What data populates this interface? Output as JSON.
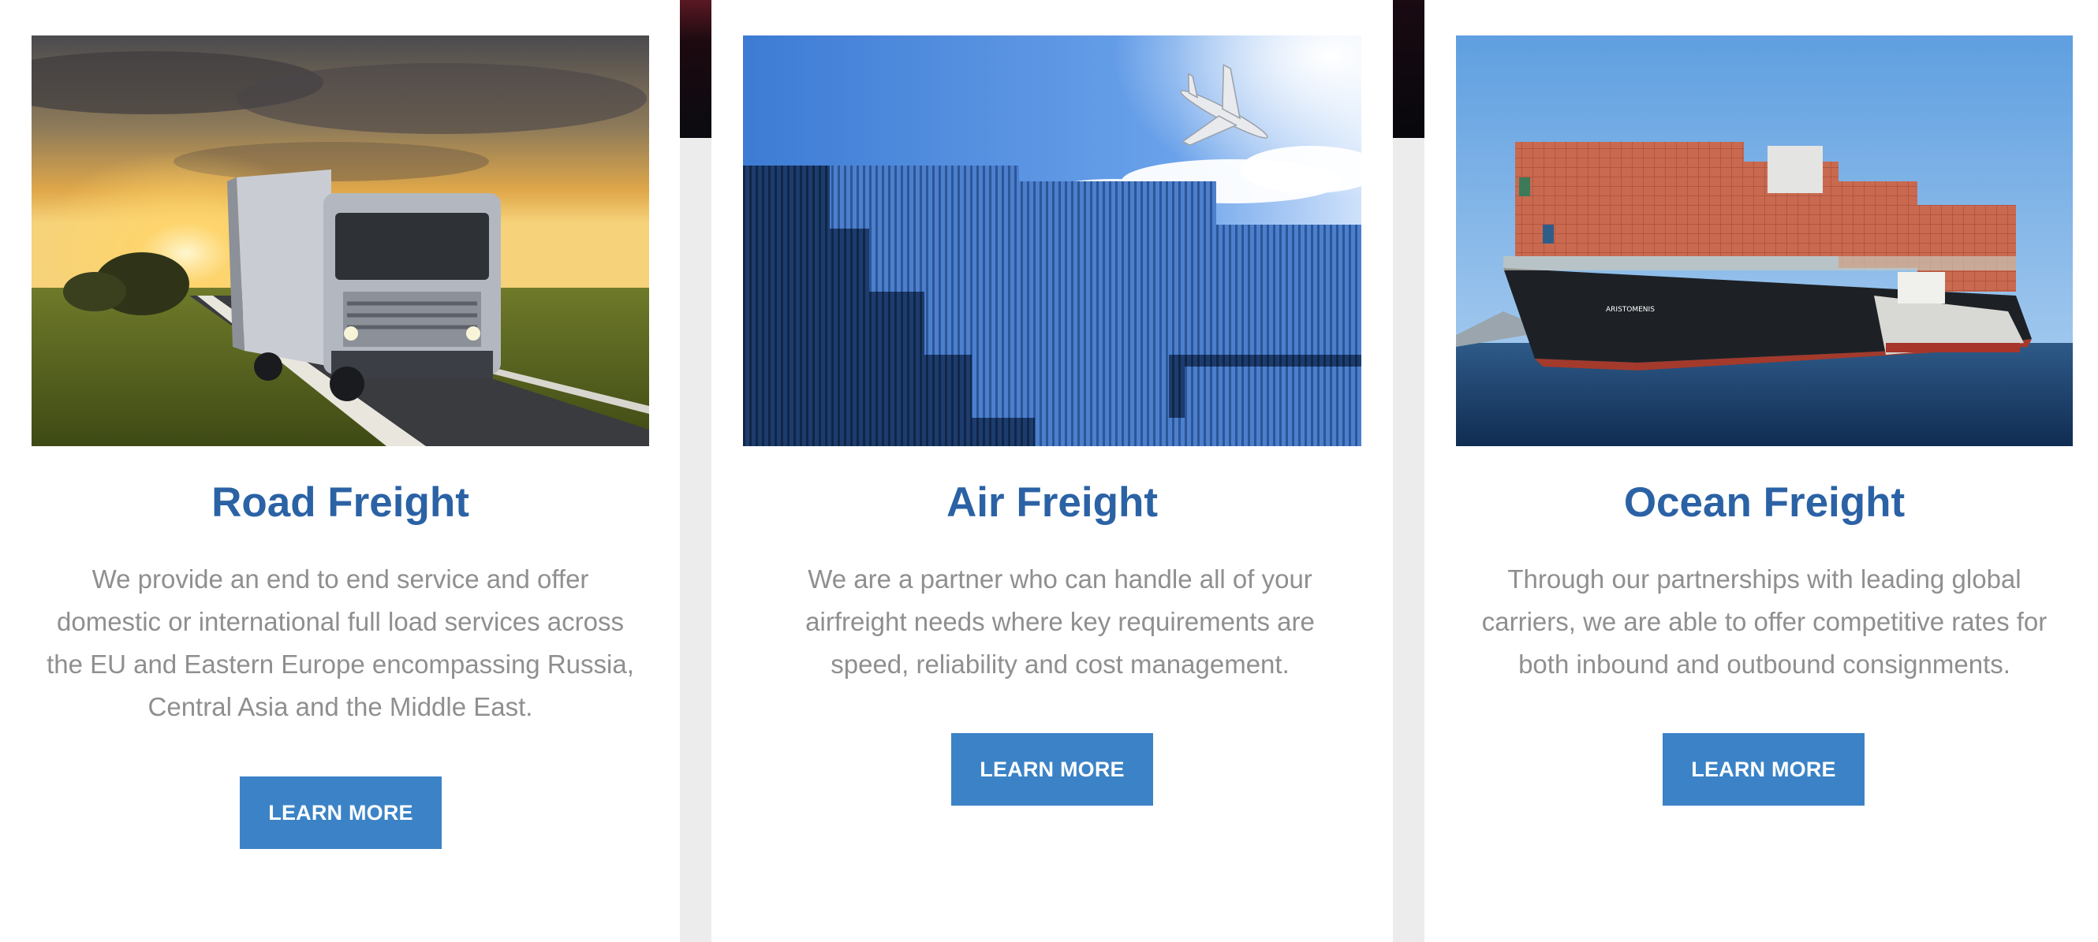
{
  "cards": [
    {
      "title": "Road Freight",
      "description": "We provide an end to end service and offer domestic or international full load services across the EU and Eastern Europe encompassing Russia, Central Asia and the Middle East.",
      "button_label": "LEARN MORE",
      "image_icon": "truck-on-road-image"
    },
    {
      "title": "Air Freight",
      "description": "We are a partner who can handle all of your airfreight needs where key requirements are speed, reliability and cost management.",
      "button_label": "LEARN MORE",
      "image_icon": "containers-and-airplane-image"
    },
    {
      "title": "Ocean Freight",
      "description": "Through our partnerships with leading global carriers, we are able to offer competitive rates for both inbound and outbound consignments.",
      "button_label": "LEARN MORE",
      "image_icon": "container-ship-image"
    }
  ],
  "ship_name": "ARISTOMENIS",
  "colors": {
    "title": "#2b62a5",
    "button": "#3b83c6",
    "body_text": "#8f8f8f",
    "background": "#ececec"
  }
}
